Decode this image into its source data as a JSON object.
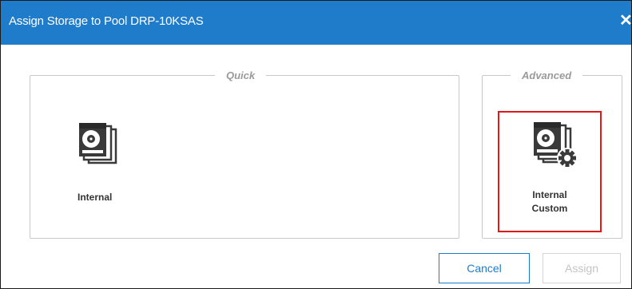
{
  "dialog": {
    "title": "Assign Storage to Pool DRP-10KSAS",
    "close_label": "✕"
  },
  "groups": {
    "quick": {
      "legend": "Quick",
      "options": [
        {
          "id": "internal",
          "label": "Internal",
          "icon": "hard-drive-stack-icon"
        }
      ]
    },
    "advanced": {
      "legend": "Advanced",
      "options": [
        {
          "id": "internal-custom",
          "label_line1": "Internal",
          "label_line2": "Custom",
          "icon": "hard-drive-gear-icon",
          "selected": true
        }
      ]
    }
  },
  "buttons": {
    "cancel": "Cancel",
    "assign": "Assign",
    "assign_enabled": false
  },
  "colors": {
    "titlebar": "#1f7ccb",
    "highlight": "#e01818",
    "legend_text": "#9a9a9a",
    "icon": "#3a3a3a"
  }
}
